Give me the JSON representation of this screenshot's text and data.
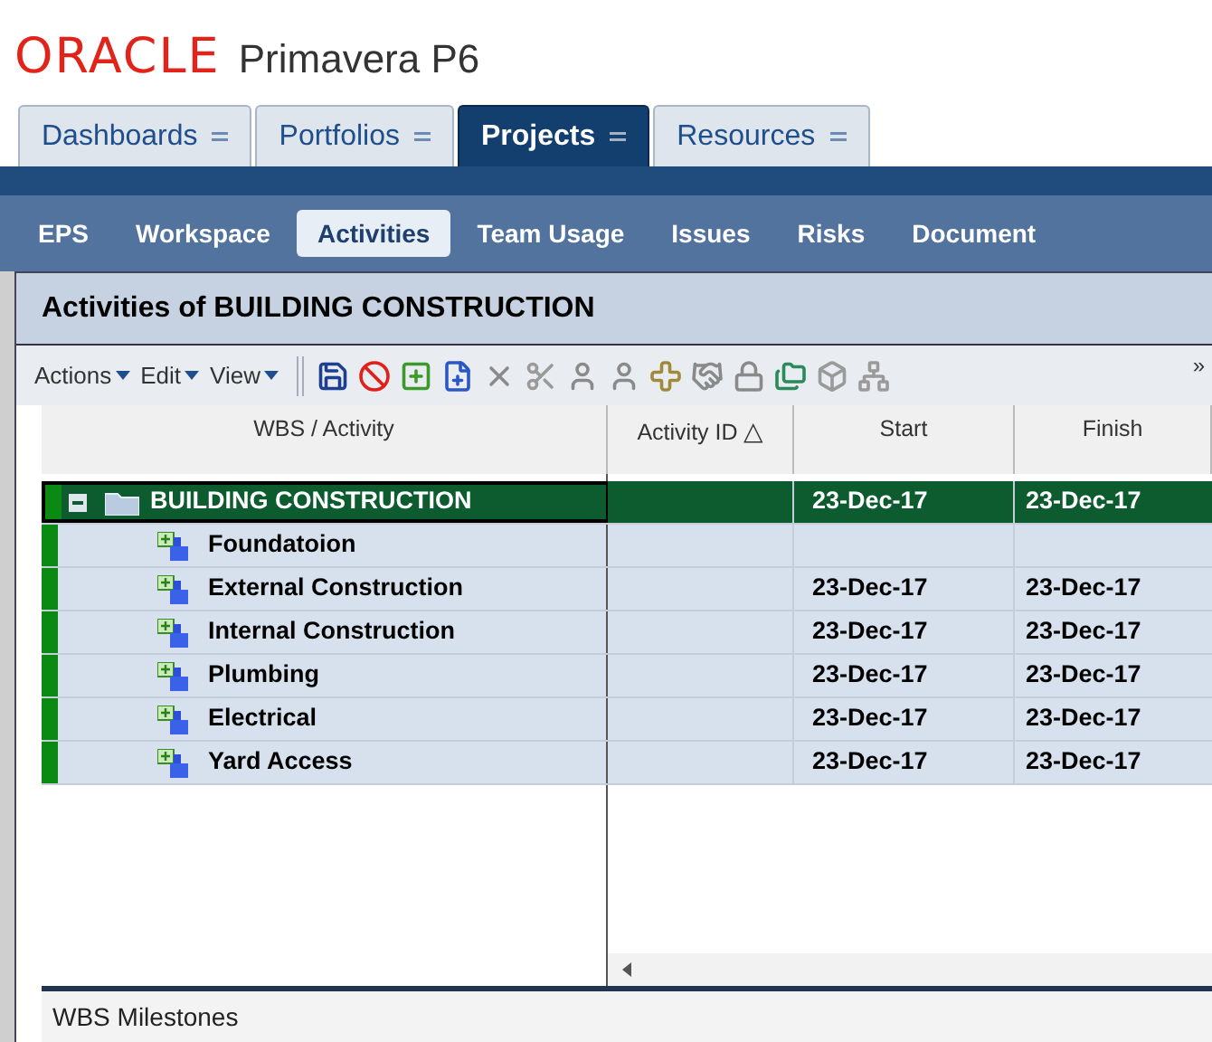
{
  "logo": {
    "brand": "ORACLE",
    "product": "Primavera P6"
  },
  "tabs": [
    {
      "label": "Dashboards",
      "selected": false
    },
    {
      "label": "Portfolios",
      "selected": false
    },
    {
      "label": "Projects",
      "selected": true
    },
    {
      "label": "Resources",
      "selected": false
    }
  ],
  "subnav": [
    {
      "label": "EPS",
      "selected": false
    },
    {
      "label": "Workspace",
      "selected": false
    },
    {
      "label": "Activities",
      "selected": true
    },
    {
      "label": "Team Usage",
      "selected": false
    },
    {
      "label": "Issues",
      "selected": false
    },
    {
      "label": "Risks",
      "selected": false
    },
    {
      "label": "Document",
      "selected": false
    }
  ],
  "panel_title": "Activities of BUILDING CONSTRUCTION",
  "toolbar": {
    "menus": [
      "Actions",
      "Edit",
      "View"
    ],
    "overflow": "»"
  },
  "table": {
    "columns": [
      {
        "label": "WBS / Activity"
      },
      {
        "label": "Activity ID",
        "sort": "△"
      },
      {
        "label": "Start"
      },
      {
        "label": "Finish"
      }
    ],
    "rows": [
      {
        "name": "BUILDING CONSTRUCTION",
        "kind": "project",
        "expanded": true,
        "selected": true,
        "start": "23-Dec-17",
        "finish": "23-Dec-17",
        "children": [
          {
            "name": "Foundatoion",
            "kind": "wbs",
            "selected": false
          },
          {
            "name": "External Construction",
            "kind": "wbs",
            "selected": false,
            "start": "23-Dec-17",
            "finish": "23-Dec-17"
          },
          {
            "name": "Internal Construction",
            "kind": "wbs",
            "selected": false,
            "start": "23-Dec-17",
            "finish": "23-Dec-17"
          },
          {
            "name": "Plumbing",
            "kind": "wbs",
            "selected": false,
            "start": "23-Dec-17",
            "finish": "23-Dec-17"
          },
          {
            "name": "Electrical",
            "kind": "wbs",
            "selected": false,
            "start": "23-Dec-17",
            "finish": "23-Dec-17"
          },
          {
            "name": "Yard Access",
            "kind": "wbs",
            "selected": false,
            "start": "23-Dec-17",
            "finish": "23-Dec-17"
          }
        ]
      }
    ]
  },
  "bottom_panel": {
    "title": "WBS Milestones"
  }
}
